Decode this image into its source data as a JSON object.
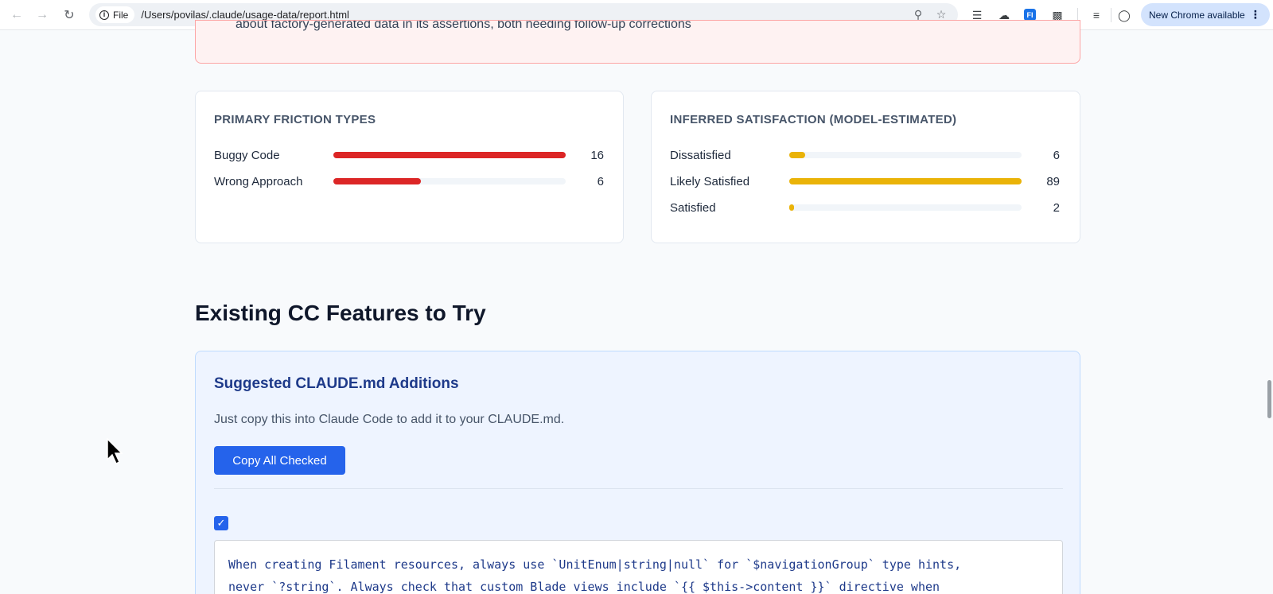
{
  "browser": {
    "file_chip": "File",
    "url": "/Users/povilas/.claude/usage-data/report.html",
    "update_label": "New Chrome available"
  },
  "alert": {
    "partial_text": "about factory-generated data in its assertions, both needing follow-up corrections"
  },
  "friction": {
    "title": "PRIMARY FRICTION TYPES",
    "color": "#dc2626",
    "items": [
      {
        "label": "Buggy Code",
        "value": "16",
        "fraction": 1.0
      },
      {
        "label": "Wrong Approach",
        "value": "6",
        "fraction": 0.375
      }
    ]
  },
  "satisfaction": {
    "title": "INFERRED SATISFACTION (MODEL-ESTIMATED)",
    "color": "#eab308",
    "items": [
      {
        "label": "Dissatisfied",
        "value": "6",
        "fraction": 0.067
      },
      {
        "label": "Likely Satisfied",
        "value": "89",
        "fraction": 1.0
      },
      {
        "label": "Satisfied",
        "value": "2",
        "fraction": 0.022
      }
    ]
  },
  "features": {
    "section_title": "Existing CC Features to Try",
    "card_title": "Suggested CLAUDE.md Additions",
    "description": "Just copy this into Claude Code to add it to your CLAUDE.md.",
    "copy_button": "Copy All Checked",
    "checkbox_checked": true,
    "code_text": "When creating Filament resources, always use `UnitEnum|string|null` for `$navigationGroup` type hints,\nnever `?string`. Always check that custom Blade views include `{{ $this->content }}` directive when"
  },
  "icons": [
    "back-arrow-icon",
    "forward-arrow-icon",
    "reload-icon",
    "info-icon",
    "zoom-icon",
    "bookmark-star-icon",
    "layers-icon",
    "cloud-icon",
    "fi-extension-icon",
    "puzzle-icon",
    "media-list-icon",
    "profile-icon",
    "more-vert-icon",
    "cursor-icon"
  ]
}
